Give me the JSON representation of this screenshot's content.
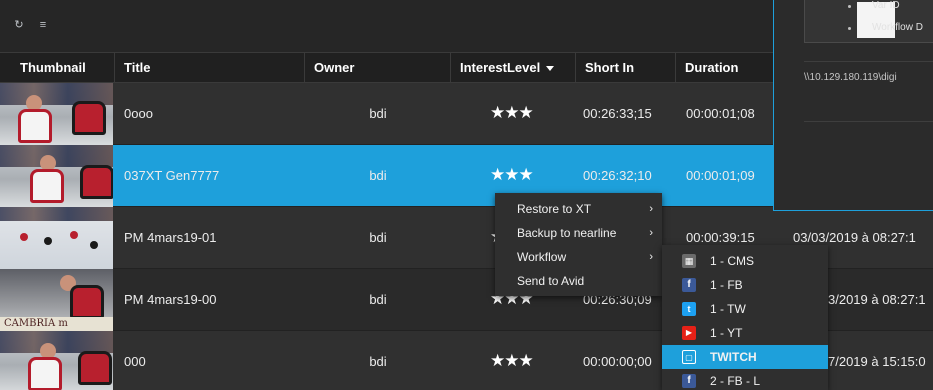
{
  "toolbar": {
    "refresh_icon": "↻",
    "menu_icon": "≡"
  },
  "columns": {
    "thumbnail": "Thumbnail",
    "title": "Title",
    "owner": "Owner",
    "interest": "InterestLevel",
    "short_in": "Short In",
    "duration": "Duration"
  },
  "rows": [
    {
      "title": "0ooo",
      "owner": "bdi",
      "interest": "★★★",
      "short_in": "00:26:33;15",
      "duration": "00:00:01;08",
      "date": ""
    },
    {
      "title": "037XT Gen7777",
      "owner": "bdi",
      "interest": "★★★",
      "short_in": "00:26:32;10",
      "duration": "00:00:01;09",
      "date": ""
    },
    {
      "title": "PM 4mars19-01",
      "owner": "bdi",
      "interest": "★",
      "short_in": "",
      "duration": "00:00:39:15",
      "date": "03/03/2019 à 08:27:1"
    },
    {
      "title": "PM 4mars19-00",
      "owner": "bdi",
      "interest": "★★★",
      "short_in": "00:26:30;09",
      "duration": "",
      "date": "3/2019 à 08:27:1"
    },
    {
      "title": "000",
      "owner": "bdi",
      "interest": "★★★",
      "short_in": "00:00:00;00",
      "duration": "",
      "date": "7/2019 à 15:15:0"
    }
  ],
  "thumb_banner": "CAMBRIA  m",
  "dialog": {
    "field1": "Var ID",
    "field2": "Workflow D",
    "path": "\\\\10.129.180.119\\digi"
  },
  "context_menu": {
    "items": [
      "Restore to XT",
      "Backup to nearline",
      "Workflow",
      "Send to Avid"
    ],
    "arrow": "›"
  },
  "submenu": {
    "items": [
      "1 - CMS",
      "1 - FB",
      "1 - TW",
      "1 - YT",
      "TWITCH",
      "2 - FB - L"
    ]
  },
  "colors": {
    "accent": "#1ea0db",
    "facebook": "#3b5998",
    "twitter": "#1da1f2",
    "youtube": "#e62117",
    "twitch": "#1ea0db"
  }
}
